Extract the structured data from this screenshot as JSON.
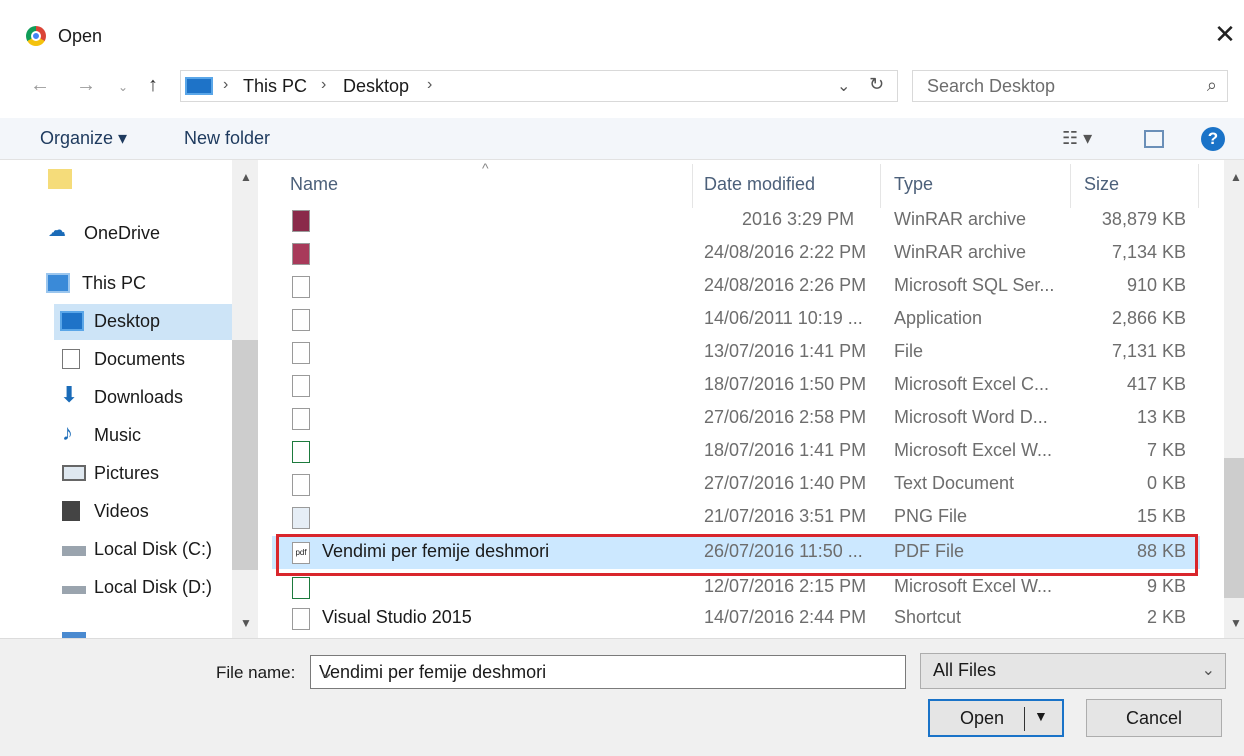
{
  "window": {
    "title": "Open",
    "close_glyph": "✕"
  },
  "address": {
    "crumbs": [
      "This PC",
      "Desktop"
    ],
    "search_placeholder": "Search Desktop"
  },
  "toolbar": {
    "organize": "Organize ▾",
    "new_folder": "New folder"
  },
  "sidebar": {
    "items": [
      {
        "label": "OneDrive",
        "icon": "cloud-icon"
      },
      {
        "label": "This PC",
        "icon": "computer-icon"
      },
      {
        "label": "Desktop",
        "icon": "desktop-icon",
        "selected": true
      },
      {
        "label": "Documents",
        "icon": "documents-icon"
      },
      {
        "label": "Downloads",
        "icon": "download-arrow-icon"
      },
      {
        "label": "Music",
        "icon": "music-note-icon"
      },
      {
        "label": "Pictures",
        "icon": "pictures-icon"
      },
      {
        "label": "Videos",
        "icon": "videos-icon"
      },
      {
        "label": "Local Disk (C:)",
        "icon": "drive-icon"
      },
      {
        "label": "Local Disk (D:)",
        "icon": "drive-icon"
      }
    ]
  },
  "columns": {
    "name": "Name",
    "date": "Date modified",
    "type": "Type",
    "size": "Size"
  },
  "files": [
    {
      "name": "",
      "date": "2016 3:29 PM",
      "type": "WinRAR archive",
      "size": "38,879 KB"
    },
    {
      "name": "",
      "date": "24/08/2016 2:22 PM",
      "type": "WinRAR archive",
      "size": "7,134 KB"
    },
    {
      "name": "",
      "date": "24/08/2016 2:26 PM",
      "type": "Microsoft SQL Ser...",
      "size": "910 KB"
    },
    {
      "name": "",
      "date": "14/06/2011 10:19 ...",
      "type": "Application",
      "size": "2,866 KB"
    },
    {
      "name": "",
      "date": "13/07/2016 1:41 PM",
      "type": "File",
      "size": "7,131 KB"
    },
    {
      "name": "",
      "date": "18/07/2016 1:50 PM",
      "type": "Microsoft Excel C...",
      "size": "417 KB"
    },
    {
      "name": "",
      "date": "27/06/2016 2:58 PM",
      "type": "Microsoft Word D...",
      "size": "13 KB"
    },
    {
      "name": "",
      "date": "18/07/2016 1:41 PM",
      "type": "Microsoft Excel W...",
      "size": "7 KB"
    },
    {
      "name": "",
      "date": "27/07/2016 1:40 PM",
      "type": "Text Document",
      "size": "0 KB"
    },
    {
      "name": "",
      "date": "21/07/2016 3:51 PM",
      "type": "PNG File",
      "size": "15 KB"
    },
    {
      "name": "Vendimi per femije deshmori",
      "date": "26/07/2016 11:50 ...",
      "type": "PDF File",
      "size": "88 KB",
      "selected": true
    },
    {
      "name": "",
      "date": "12/07/2016 2:15 PM",
      "type": "Microsoft Excel W...",
      "size": "9 KB"
    },
    {
      "name": "Visual Studio 2015",
      "date": "14/07/2016 2:44 PM",
      "type": "Shortcut",
      "size": "2 KB"
    }
  ],
  "bottom": {
    "file_name_label": "File name:",
    "file_name_value": "Vendimi per femije deshmori",
    "filter": "All Files",
    "open": "Open",
    "cancel": "Cancel"
  }
}
